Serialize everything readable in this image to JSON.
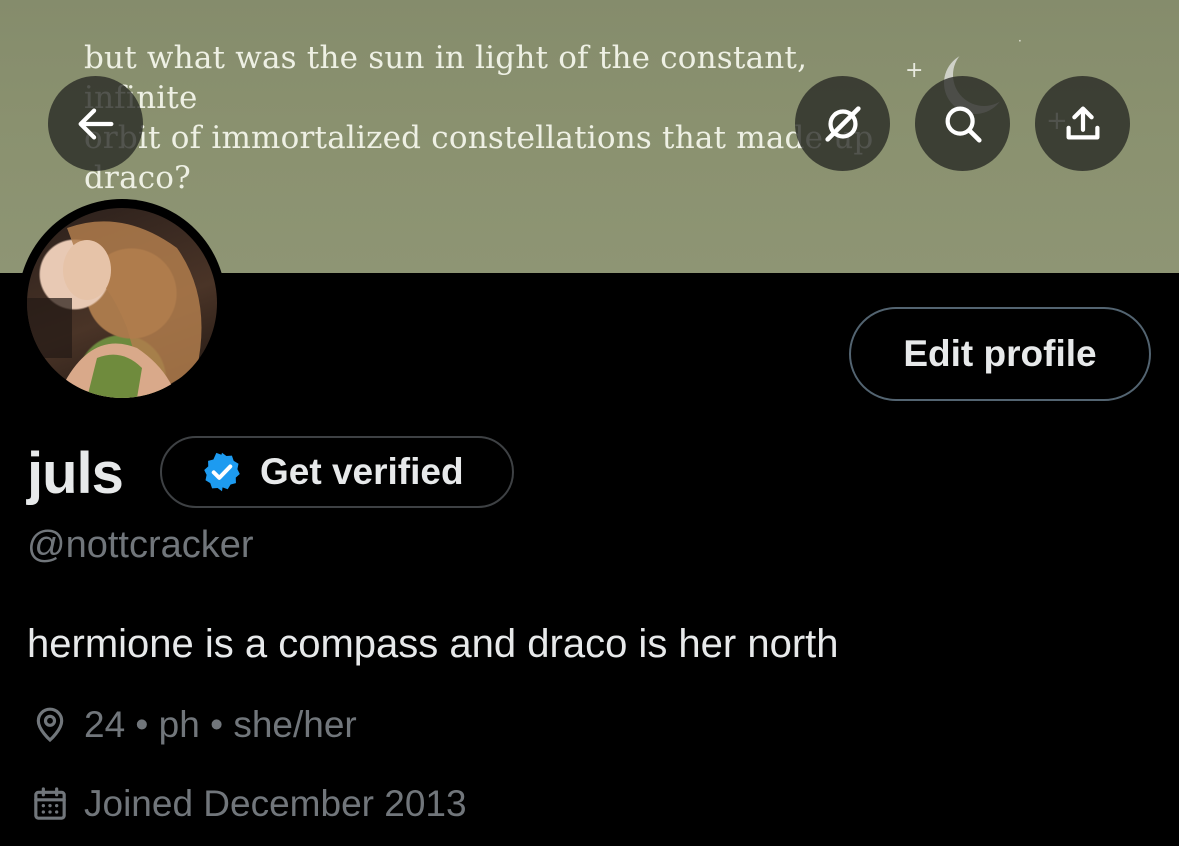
{
  "banner": {
    "quote_lines": [
      "but what was the sun in light of the constant, infinite",
      "orbit of immortalized constellations that made up",
      "draco?"
    ]
  },
  "header_buttons": {
    "back_icon": "arrow-left-icon",
    "grok_icon": "grok-icon",
    "search_icon": "search-icon",
    "share_icon": "share-icon"
  },
  "profile": {
    "edit_label": "Edit profile",
    "display_name": "juls",
    "verify_label": "Get verified",
    "handle": "@nottcracker",
    "bio": "hermione is a compass and draco is her north",
    "location": "24 • ph • she/her",
    "joined": "Joined December 2013"
  },
  "colors": {
    "background": "#000000",
    "banner": "#8a916f",
    "verified_blue": "#1d9bf0",
    "muted_text": "#71767b",
    "primary_text": "#e7e9ea"
  }
}
